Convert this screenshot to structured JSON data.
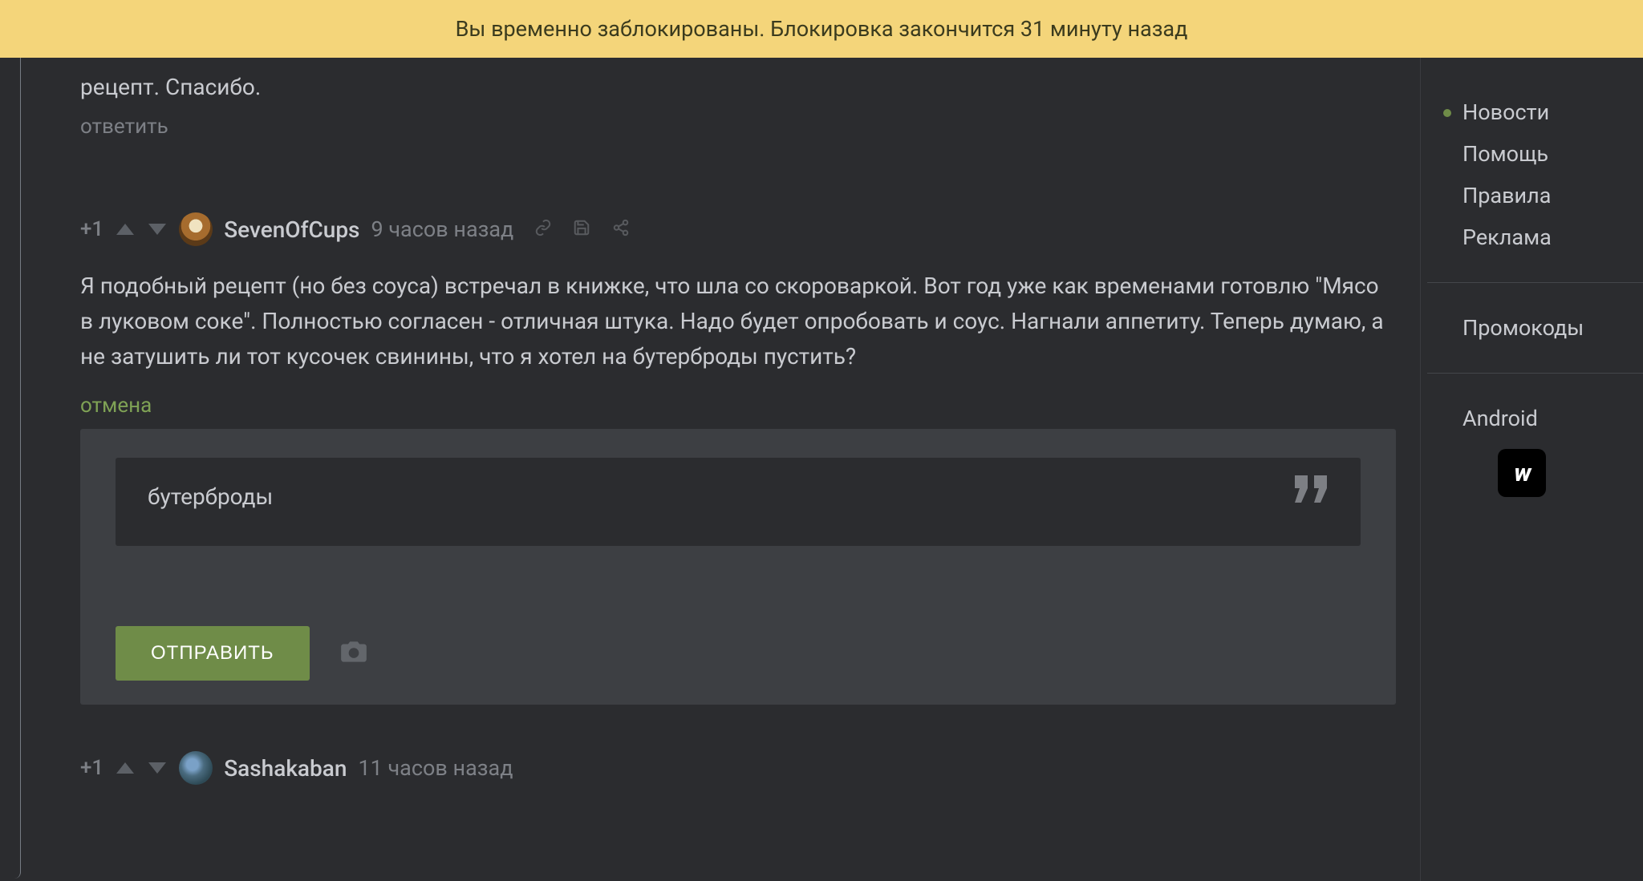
{
  "banner": {
    "text": "Вы временно заблокированы. Блокировка закончится 31 минуту назад"
  },
  "prev_comment": {
    "tail": "рецепт. Спасибо.",
    "reply": "ответить"
  },
  "comment": {
    "score": "+1",
    "username": "SevenOfCups",
    "time": "9 часов назад",
    "body": "Я подобный рецепт (но без соуса) встречал в книжке, что шла со скороваркой. Вот год уже как временами готовлю \"Мясо в луковом соке\". Полностью согласен - отличная штука. Надо будет опробовать и соус. Нагнали аппетиту. Теперь думаю, а не затушить ли тот кусочек свинины, что я хотел на бутерброды пустить?",
    "cancel": "отмена"
  },
  "reply_box": {
    "quote": "бутерброды",
    "send": "ОТПРАВИТЬ"
  },
  "next_comment": {
    "score": "+1",
    "username": "Sashakaban",
    "time": "11 часов назад"
  },
  "sidebar": {
    "links": {
      "news": "Новости",
      "help": "Помощь",
      "rules": "Правила",
      "ads": "Реклама"
    },
    "promo": "Промокоды",
    "android": "Android",
    "vk": "w"
  }
}
